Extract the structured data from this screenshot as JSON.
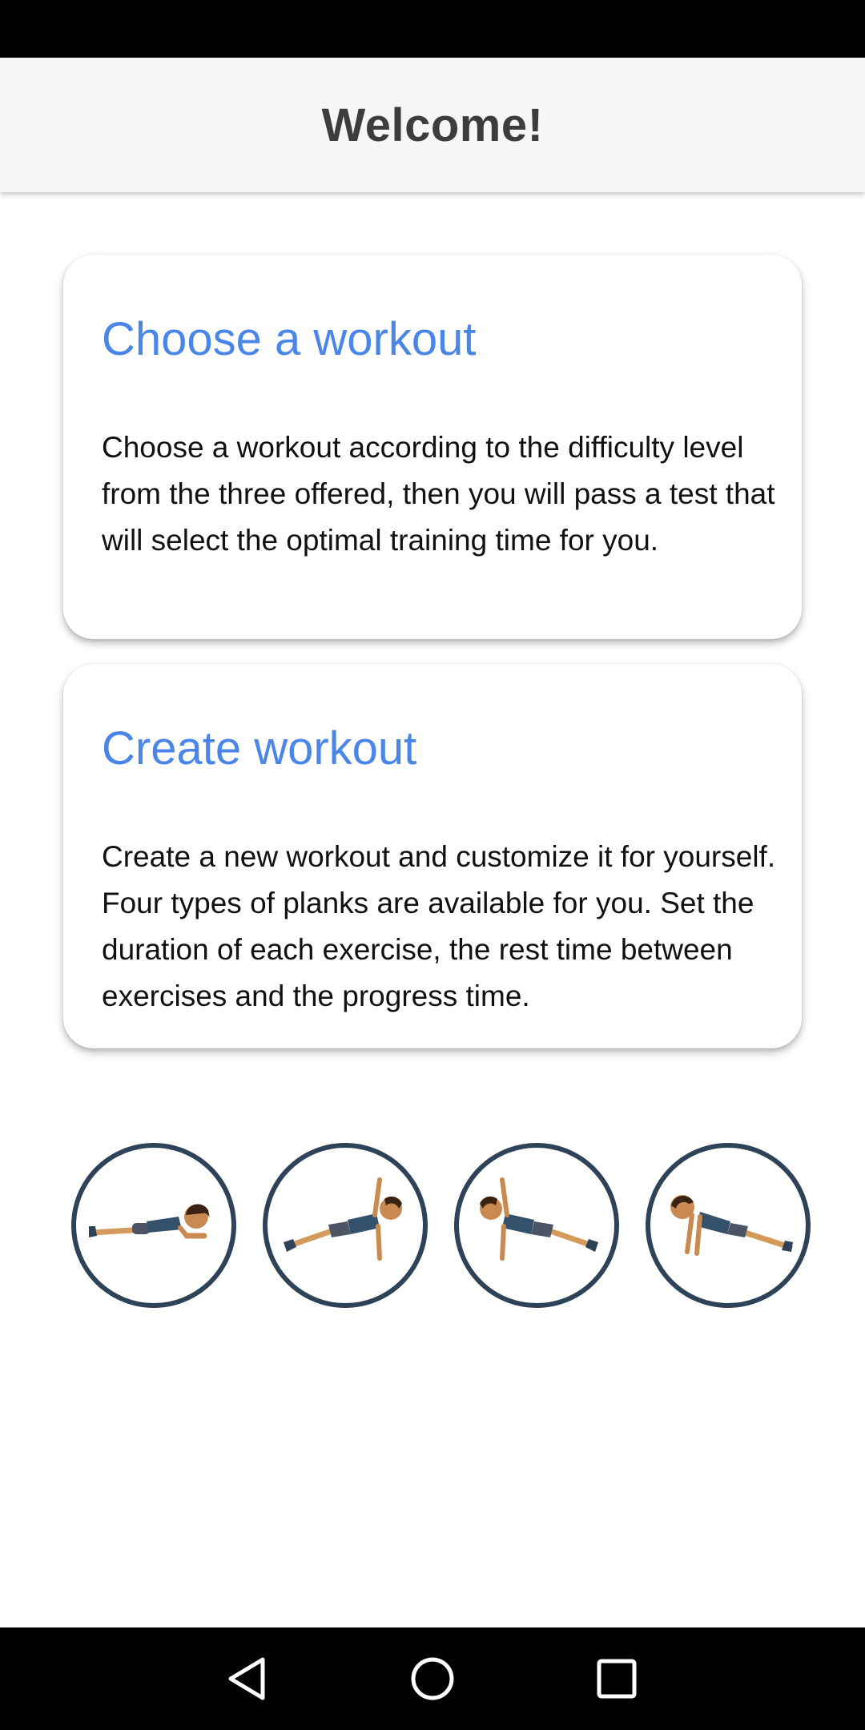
{
  "app_bar": {
    "title": "Welcome!"
  },
  "cards": [
    {
      "title": "Choose a workout",
      "description": "Choose a workout according to the difficulty level from the three offered, then you will pass a test that will select the optimal training time for you."
    },
    {
      "title": "Create workout",
      "description": "Create a new workout and customize it for yourself. Four types of planks are available for you. Set the duration of each exercise, the rest time between exercises and the progress time."
    }
  ],
  "exercises": [
    {
      "icon": "forearm-plank-icon"
    },
    {
      "icon": "side-plank-left-icon"
    },
    {
      "icon": "side-plank-right-icon"
    },
    {
      "icon": "high-plank-icon"
    }
  ],
  "nav": {
    "back_icon": "back-triangle-icon",
    "home_icon": "home-circle-icon",
    "recent_icon": "recents-square-icon"
  },
  "colors": {
    "accent": "#4a86e8",
    "circle_border": "#2e4358",
    "app_bar_bg": "#f6f6f6",
    "title_text": "#3d3d3d"
  }
}
